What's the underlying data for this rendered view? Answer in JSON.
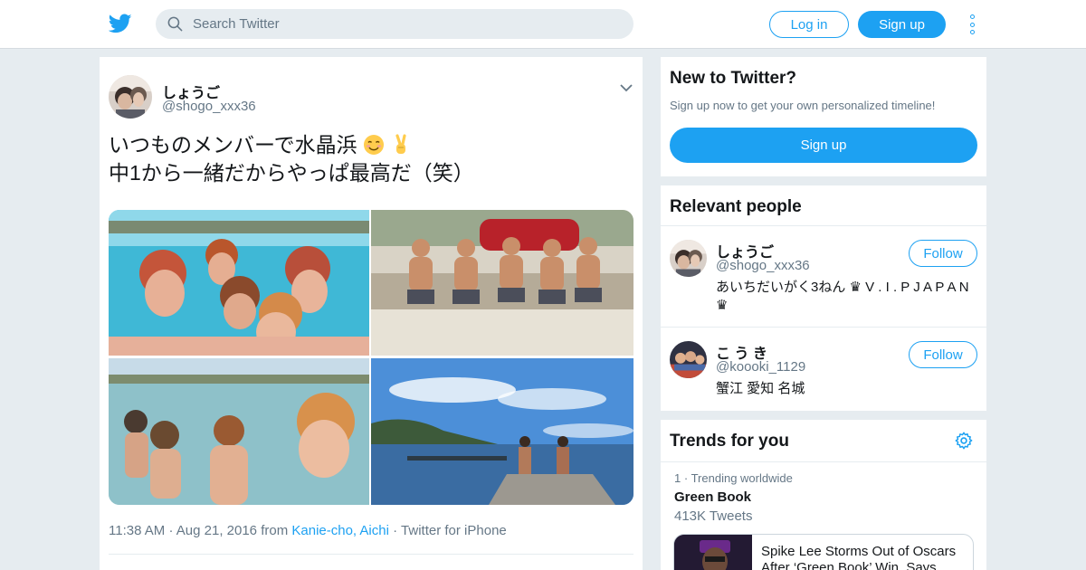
{
  "header": {
    "search_placeholder": "Search Twitter",
    "login_label": "Log in",
    "signup_label": "Sign up"
  },
  "tweet": {
    "user_name": "しょうご",
    "user_handle": "@shogo_xxx36",
    "text_line1": "いつものメンバーで水晶浜",
    "text_line2": "中1から一緒だからやっぱ最高だ（笑）",
    "emoji_line1": [
      "smiling-face-emoji",
      "victory-hand-emoji"
    ],
    "photo_count": 4,
    "time": "11:38 AM",
    "date": "Aug 21, 2016",
    "from_label": "from",
    "location": "Kanie-cho, Aichi",
    "source": "Twitter for iPhone",
    "separator": "·"
  },
  "new_to_twitter": {
    "title": "New to Twitter?",
    "subtitle": "Sign up now to get your own personalized timeline!",
    "signup_label": "Sign up"
  },
  "relevant_people": {
    "title": "Relevant people",
    "people": [
      {
        "name": "しょうご",
        "handle": "@shogo_xxx36",
        "bio_line1": "あいちだいがく3ねん ♛ V . I . P J A P A N",
        "bio_line2": "♛",
        "follow_label": "Follow"
      },
      {
        "name": "こ う き",
        "handle": "@koooki_1129",
        "bio_line1": "蟹江 愛知 名城",
        "bio_line2": "",
        "follow_label": "Follow"
      }
    ]
  },
  "trends": {
    "title": "Trends for you",
    "items": [
      {
        "rank": "1",
        "meta": "Trending worldwide",
        "name": "Green Book",
        "count": "413K Tweets",
        "news_headline_line1": "Spike Lee Storms Out of Oscars",
        "news_headline_line2": "After ‘Green Book’ Win, Says"
      }
    ]
  },
  "colors": {
    "accent": "#1da1f2",
    "background": "#e6ecf0",
    "secondary_text": "#657786",
    "primary_text": "#14171a"
  }
}
